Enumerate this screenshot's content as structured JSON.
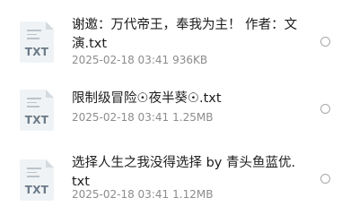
{
  "files": [
    {
      "icon": "txt-file-icon",
      "icon_label": "TXT",
      "name": "谢邀：万代帝王，奉我为主！ 作者：文演.txt",
      "date": "2025-02-18 03:41",
      "size": "936KB",
      "selected": false
    },
    {
      "icon": "txt-file-icon",
      "icon_label": "TXT",
      "name": "限制级冒险☉夜半葵☉.txt",
      "date": "2025-02-18 03:41",
      "size": "1.25MB",
      "selected": false
    },
    {
      "icon": "txt-file-icon",
      "icon_label": "TXT",
      "name": "选择人生之我没得选择 by 青头鱼蓝优.txt",
      "date": "2025-02-18 03:41",
      "size": "1.12MB",
      "selected": false
    }
  ],
  "colors": {
    "title_text": "#1c1c1c",
    "meta_text": "#8c8c8c",
    "icon_bg": "#f0f3f5",
    "icon_label": "#6b7a88",
    "radio_border": "#a8a8a8"
  }
}
